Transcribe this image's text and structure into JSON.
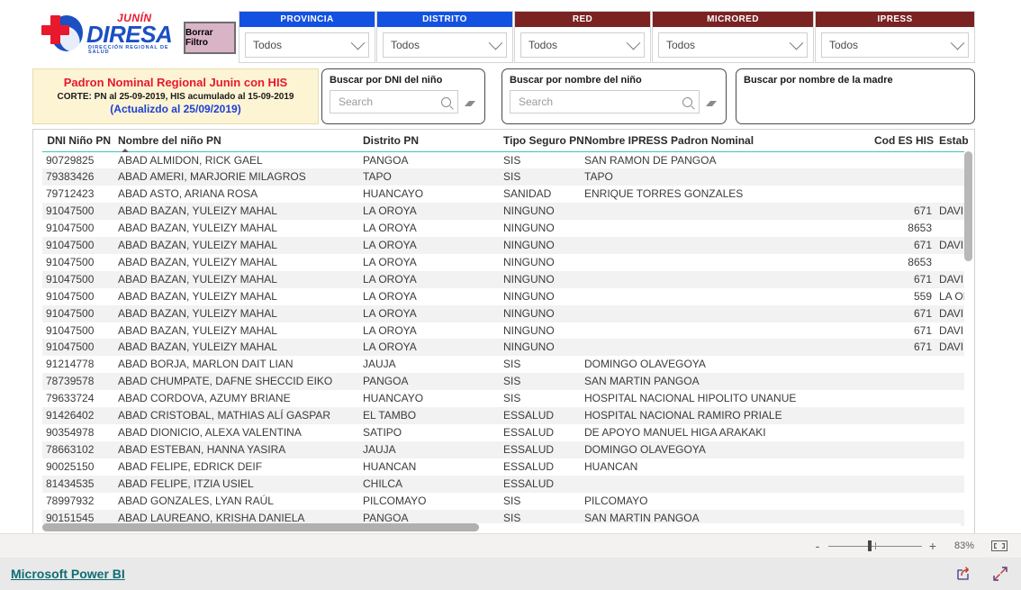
{
  "logo": {
    "brand_top": "JUNÍN",
    "brand_main": "DIRESA",
    "brand_sub": "DIRECCIÓN REGIONAL DE SALUD"
  },
  "toolbar": {
    "clear_filter_label": "Borrar Filtro"
  },
  "slicers": [
    {
      "title": "PROVINCIA",
      "value": "Todos",
      "color": "#1352e0"
    },
    {
      "title": "DISTRITO",
      "value": "Todos",
      "color": "#1352e0"
    },
    {
      "title": "RED",
      "value": "Todos",
      "color": "#7b2222"
    },
    {
      "title": "MICRORED",
      "value": "Todos",
      "color": "#7b2222"
    },
    {
      "title": "IPRESS",
      "value": "Todos",
      "color": "#7b2222"
    }
  ],
  "title_card": {
    "main": "Padron Nominal Regional Junin con HIS",
    "sub": "CORTE: PN al 25-09-2019, HIS acumulado al 15-09-2019",
    "updated": "(Actualizdo al 25/09/2019)"
  },
  "searches": [
    {
      "label": "Buscar por DNI del niño",
      "placeholder": "Search",
      "value": ""
    },
    {
      "label": "Buscar por nombre del niño",
      "placeholder": "Search",
      "value": ""
    }
  ],
  "mother_search": {
    "label": "Buscar por nombre de la madre"
  },
  "table": {
    "columns": [
      "DNI Niño PN",
      "Nombre del niño PN",
      "Distrito PN",
      "Tipo Seguro PN",
      "Nombre IPRESS Padron Nominal",
      "Cod ES HIS",
      "Estab"
    ],
    "sorted_column_index": 1,
    "sort_direction": "asc",
    "rows": [
      [
        "90729825",
        "ABAD ALMIDON, RICK GAEL",
        "PANGOA",
        "SIS",
        "SAN RAMON DE PANGOA",
        "",
        ""
      ],
      [
        "79383426",
        "ABAD AMERI, MARJORIE MILAGROS",
        "TAPO",
        "SIS",
        "TAPO",
        "",
        ""
      ],
      [
        "79712423",
        "ABAD ASTO, ARIANA ROSA",
        "HUANCAYO",
        "SANIDAD",
        "ENRIQUE TORRES GONZALES",
        "",
        ""
      ],
      [
        "91047500",
        "ABAD BAZAN, YULEIZY MAHAL",
        "LA OROYA",
        "NINGUNO",
        "",
        "671",
        "DAVII"
      ],
      [
        "91047500",
        "ABAD BAZAN, YULEIZY MAHAL",
        "LA OROYA",
        "NINGUNO",
        "",
        "8653",
        ""
      ],
      [
        "91047500",
        "ABAD BAZAN, YULEIZY MAHAL",
        "LA OROYA",
        "NINGUNO",
        "",
        "671",
        "DAVII"
      ],
      [
        "91047500",
        "ABAD BAZAN, YULEIZY MAHAL",
        "LA OROYA",
        "NINGUNO",
        "",
        "8653",
        ""
      ],
      [
        "91047500",
        "ABAD BAZAN, YULEIZY MAHAL",
        "LA OROYA",
        "NINGUNO",
        "",
        "671",
        "DAVII"
      ],
      [
        "91047500",
        "ABAD BAZAN, YULEIZY MAHAL",
        "LA OROYA",
        "NINGUNO",
        "",
        "559",
        "LA OI"
      ],
      [
        "91047500",
        "ABAD BAZAN, YULEIZY MAHAL",
        "LA OROYA",
        "NINGUNO",
        "",
        "671",
        "DAVII"
      ],
      [
        "91047500",
        "ABAD BAZAN, YULEIZY MAHAL",
        "LA OROYA",
        "NINGUNO",
        "",
        "671",
        "DAVII"
      ],
      [
        "91047500",
        "ABAD BAZAN, YULEIZY MAHAL",
        "LA OROYA",
        "NINGUNO",
        "",
        "671",
        "DAVII"
      ],
      [
        "91214778",
        "ABAD BORJA, MARLON DAIT LIAN",
        "JAUJA",
        "SIS",
        "DOMINGO OLAVEGOYA",
        "",
        ""
      ],
      [
        "78739578",
        "ABAD CHUMPATE, DAFNE SHECCID EIKO",
        "PANGOA",
        "SIS",
        "SAN MARTIN PANGOA",
        "",
        ""
      ],
      [
        "79633724",
        "ABAD CORDOVA, AZUMY BRIANE",
        "HUANCAYO",
        "SIS",
        "HOSPITAL NACIONAL HIPOLITO UNANUE",
        "",
        ""
      ],
      [
        "91426402",
        "ABAD CRISTOBAL, MATHIAS ALÍ GASPAR",
        "EL TAMBO",
        "ESSALUD",
        "HOSPITAL NACIONAL RAMIRO PRIALE",
        "",
        ""
      ],
      [
        "90354978",
        "ABAD DIONICIO, ALEXA VALENTINA",
        "SATIPO",
        "ESSALUD",
        "DE APOYO MANUEL HIGA ARAKAKI",
        "",
        ""
      ],
      [
        "78663102",
        "ABAD ESTEBAN, HANNA YASIRA",
        "JAUJA",
        "ESSALUD",
        "DOMINGO OLAVEGOYA",
        "",
        ""
      ],
      [
        "90025150",
        "ABAD FELIPE, EDRICK DEIF",
        "HUANCAN",
        "ESSALUD",
        "HUANCAN",
        "",
        ""
      ],
      [
        "81434535",
        "ABAD FELIPE, ITZIA USIEL",
        "CHILCA",
        "ESSALUD",
        "",
        "",
        ""
      ],
      [
        "78997932",
        "ABAD GONZALES, LYAN RAÚL",
        "PILCOMAYO",
        "SIS",
        "PILCOMAYO",
        "",
        ""
      ],
      [
        "90151545",
        "ABAD LAUREANO, KRISHA DANIELA",
        "PANGOA",
        "SIS",
        "SAN MARTIN PANGOA",
        "",
        ""
      ]
    ]
  },
  "zoom_bar": {
    "minus_label": "-",
    "plus_label": "+",
    "percent": "83%",
    "fit_icon": "fit-to-page-icon"
  },
  "footer": {
    "link_label": "Microsoft Power BI",
    "share_icon": "share-icon",
    "fullscreen_icon": "fullscreen-icon"
  }
}
